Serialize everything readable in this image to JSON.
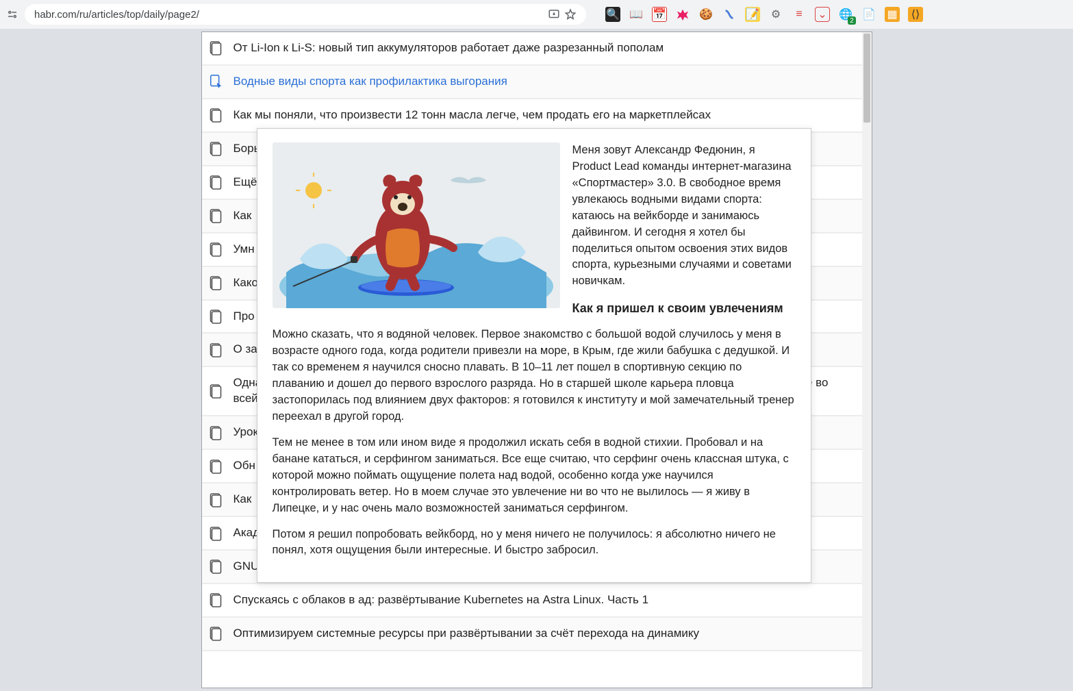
{
  "browser": {
    "url": "habr.com/ru/articles/top/daily/page2/",
    "extension_badge": "2"
  },
  "articles": [
    {
      "title": "От Li-Ion к Li-S: новый тип аккумуляторов работает даже разрезанный пополам",
      "active": false
    },
    {
      "title": "Водные виды спорта как профилактика выгорания",
      "active": true
    },
    {
      "title": "Как мы поняли, что произвести 12 тонн масла легче, чем продать его на маркетплейсах",
      "active": false
    },
    {
      "title": "Борь",
      "active": false
    },
    {
      "title": "Ещё",
      "active": false
    },
    {
      "title": "Как",
      "active": false
    },
    {
      "title": "Умн",
      "active": false
    },
    {
      "title": "Како",
      "active": false
    },
    {
      "title": "Про",
      "active": false
    },
    {
      "title": "О за",
      "active": false
    },
    {
      "title": "Однажды мы проснулись и увидели, что половина датчиков и сенсоров отправляет неправильные данные во всей экос",
      "active": false
    },
    {
      "title": "Урок",
      "active": false
    },
    {
      "title": "Обн",
      "active": false
    },
    {
      "title": "Как",
      "active": false
    },
    {
      "title": "Акад",
      "active": false
    },
    {
      "title": "GNUstep: разрывая все шаблоны",
      "active": false
    },
    {
      "title": "Спускаясь с облаков в ад: развёртывание Kubernetes на Astra Linux. Часть 1",
      "active": false
    },
    {
      "title": "Оптимизируем системные ресурсы при развёртывании за счёт перехода на динамику",
      "active": false
    }
  ],
  "preview": {
    "intro": "Меня зовут Александр Федюнин, я Product Lead команды интернет-магазина «Спортмастер» 3.0. В свободное время увлекаюсь водными видами спорта: катаюсь на вейкборде и занимаюсь дайвингом. И сегодня я хотел бы поделиться опытом освоения этих видов спорта, курьезными случаями и советами новичкам.",
    "heading": "Как я пришел к своим увлечениям",
    "p1": "Можно сказать, что я водяной человек. Первое знакомство с большой водой случилось у меня в возрасте одного года, когда родители привезли на море, в Крым, где жили бабушка с дедушкой. И так со временем я научился сносно плавать. В 10–11 лет пошел в спортивную секцию по плаванию и дошел до первого взрослого разряда. Но в старшей школе карьера пловца застопорилась под влиянием двух факторов: я готовился к институту и мой замечательный тренер переехал в другой город.",
    "p2": "Тем не менее в том или ином виде я продолжил искать себя в водной стихии. Пробовал и на банане кататься, и серфингом заниматься. Все еще считаю, что серфинг очень классная штука, с которой можно поймать ощущение полета над водой, особенно когда уже научился контролировать ветер. Но в моем случае это увлечение ни во что не вылилось — я живу в Липецке, и у нас очень мало возможностей заниматься серфингом.",
    "p3": "Потом я решил попробовать вейкборд, но у меня ничего не получилось: я абсолютно ничего не понял, хотя ощущения были интересные. И быстро забросил."
  }
}
